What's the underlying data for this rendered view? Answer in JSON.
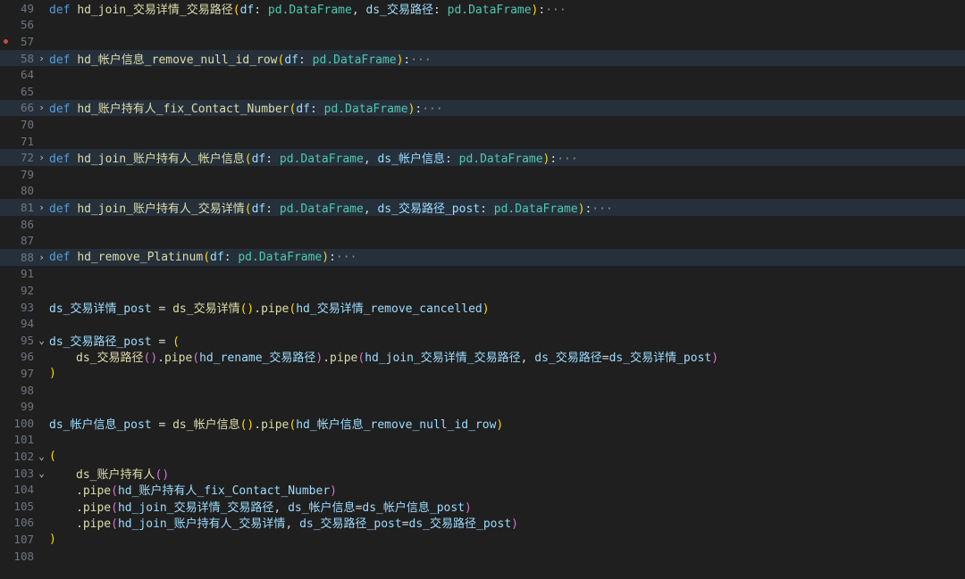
{
  "lines": {
    "l49": {
      "num": "49",
      "code": [
        "def",
        " ",
        "hd_join_交易详情_交易路径",
        "(",
        "df",
        ": ",
        "pd.DataFrame",
        ", ",
        "ds_交易路径",
        ": ",
        "pd.DataFrame",
        ")",
        ":",
        "···"
      ]
    },
    "l56": {
      "num": "56"
    },
    "l57": {
      "num": "57"
    },
    "l58": {
      "num": "58",
      "code": [
        "def",
        " ",
        "hd_帐户信息_remove_null_id_row",
        "(",
        "df",
        ": ",
        "pd.DataFrame",
        ")",
        ":",
        "···"
      ]
    },
    "l64": {
      "num": "64"
    },
    "l65": {
      "num": "65"
    },
    "l66": {
      "num": "66",
      "code": [
        "def",
        " ",
        "hd_账户持有人_fix_Contact_Number",
        "(",
        "df",
        ": ",
        "pd.DataFrame",
        ")",
        ":",
        "···"
      ]
    },
    "l70": {
      "num": "70"
    },
    "l71": {
      "num": "71"
    },
    "l72": {
      "num": "72",
      "code": [
        "def",
        " ",
        "hd_join_账户持有人_帐户信息",
        "(",
        "df",
        ": ",
        "pd.DataFrame",
        ", ",
        "ds_帐户信息",
        ": ",
        "pd.DataFrame",
        ")",
        ":",
        "···"
      ]
    },
    "l79": {
      "num": "79"
    },
    "l80": {
      "num": "80"
    },
    "l81": {
      "num": "81",
      "code": [
        "def",
        " ",
        "hd_join_账户持有人_交易详情",
        "(",
        "df",
        ": ",
        "pd.DataFrame",
        ", ",
        "ds_交易路径_post",
        ": ",
        "pd.DataFrame",
        ")",
        ":",
        "···"
      ]
    },
    "l86": {
      "num": "86"
    },
    "l87": {
      "num": "87"
    },
    "l88": {
      "num": "88",
      "code": [
        "def",
        " ",
        "hd_remove_Platinum",
        "(",
        "df",
        ": ",
        "pd.DataFrame",
        ")",
        ":",
        "···"
      ]
    },
    "l91": {
      "num": "91"
    },
    "l92": {
      "num": "92"
    },
    "l93": {
      "num": "93",
      "code": [
        "ds_交易详情_post",
        " = ",
        "ds_交易详情",
        "(",
        ")",
        ".",
        "pipe",
        "(",
        "hd_交易详情_remove_cancelled",
        ")"
      ]
    },
    "l94": {
      "num": "94"
    },
    "l95": {
      "num": "95",
      "code": [
        "ds_交易路径_post",
        " = ",
        "("
      ]
    },
    "l96": {
      "num": "96",
      "code": [
        "ds_交易路径",
        "(",
        ")",
        ".",
        "pipe",
        "(",
        "hd_rename_交易路径",
        ")",
        ".",
        "pipe",
        "(",
        "hd_join_交易详情_交易路径",
        ", ",
        "ds_交易路径",
        "=",
        "ds_交易详情_post",
        ")"
      ]
    },
    "l97": {
      "num": "97",
      "code": [
        ")"
      ]
    },
    "l98": {
      "num": "98"
    },
    "l99": {
      "num": "99"
    },
    "l100": {
      "num": "100",
      "code": [
        "ds_帐户信息_post",
        " = ",
        "ds_帐户信息",
        "(",
        ")",
        ".",
        "pipe",
        "(",
        "hd_帐户信息_remove_null_id_row",
        ")"
      ]
    },
    "l101": {
      "num": "101"
    },
    "l102": {
      "num": "102",
      "code": [
        "("
      ]
    },
    "l103": {
      "num": "103",
      "code": [
        "ds_账户持有人",
        "(",
        ")"
      ]
    },
    "l104": {
      "num": "104",
      "code": [
        ".",
        "pipe",
        "(",
        "hd_账户持有人_fix_Contact_Number",
        ")"
      ]
    },
    "l105": {
      "num": "105",
      "code": [
        ".",
        "pipe",
        "(",
        "hd_join_交易详情_交易路径",
        ", ",
        "ds_帐户信息",
        "=",
        "ds_帐户信息_post",
        ")"
      ]
    },
    "l106": {
      "num": "106",
      "code": [
        ".",
        "pipe",
        "(",
        "hd_join_账户持有人_交易详情",
        ", ",
        "ds_交易路径_post",
        "=",
        "ds_交易路径_post",
        ")"
      ]
    },
    "l107": {
      "num": "107",
      "code": [
        ")"
      ]
    },
    "l108": {
      "num": "108"
    }
  },
  "colors": {
    "background": "#1f1f1f",
    "folded_line_bg": "#26303b",
    "keyword": "#569cd6",
    "function": "#dcdcaa",
    "variable": "#9cdcfe",
    "type": "#4ec9b0",
    "bracket_1": "#ffd700",
    "bracket_2": "#da70d6",
    "breakpoint": "#c74e39"
  },
  "icons": {
    "fold_collapsed": "chevron-right-icon",
    "fold_expanded": "chevron-down-icon",
    "breakpoint": "breakpoint-dot-icon"
  }
}
